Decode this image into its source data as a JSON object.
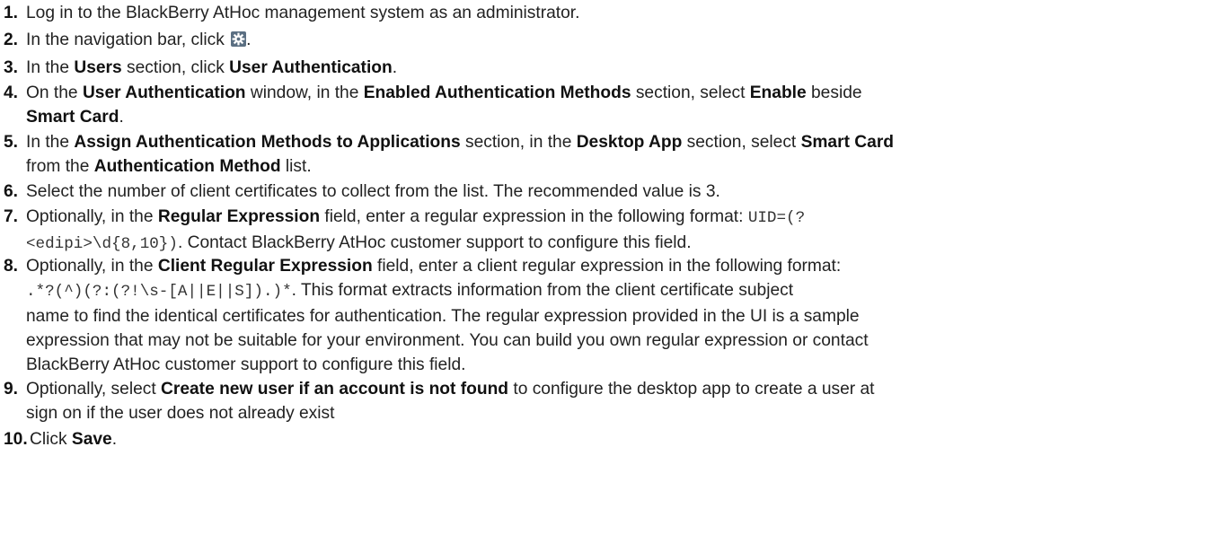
{
  "steps": [
    {
      "number": "1.",
      "parts": {
        "a": "Log in to the BlackBerry AtHoc management system as an administrator."
      }
    },
    {
      "number": "2.",
      "parts": {
        "a": "In the navigation bar, click",
        "icon": "gear-icon",
        "b": "."
      }
    },
    {
      "number": "3.",
      "parts": {
        "a": "In the ",
        "b1": "Users",
        "c": " section, click ",
        "b2": "User Authentication",
        "d": "."
      }
    },
    {
      "number": "4.",
      "parts": {
        "a": "On the ",
        "b1": "User Authentication",
        "c": " window, in the ",
        "b2": "Enabled Authentication Methods",
        "d": " section, select ",
        "b3": "Enable",
        "e": " beside",
        "b4": "Smart Card",
        "f": "."
      }
    },
    {
      "number": "5.",
      "parts": {
        "a": "In the ",
        "b1": "Assign Authentication Methods to Applications",
        "c": " section, in the ",
        "b2": "Desktop App",
        "d": " section, select ",
        "b3": "Smart Card",
        "e": "from the ",
        "b4": "Authentication Method",
        "f": " list."
      }
    },
    {
      "number": "6.",
      "parts": {
        "a": "Select the number of client certificates to collect from the list. The recommended value is 3."
      }
    },
    {
      "number": "7.",
      "parts": {
        "a": "Optionally, in the ",
        "b1": "Regular Expression",
        "c": " field, enter a regular expression in the following format: ",
        "code1": "UID=(?",
        "code2": "<edipi>\\d{8,10})",
        "d": ". Contact BlackBerry AtHoc customer support to configure this field."
      }
    },
    {
      "number": "8.",
      "parts": {
        "a": "Optionally, in the ",
        "b1": "Client Regular Expression",
        "c": " field, enter a client regular expression in the following format:",
        "code1": ".*?(^)(?:(?!\\s-[A||E||S]).)*",
        "d": ". This format extracts information from the client certificate subject",
        "e": "name to find the identical certificates for authentication. The regular expression provided in the UI is a sample",
        "f": "expression that may not be suitable for your environment. You can build you own regular expression or contact",
        "g": "BlackBerry AtHoc customer support to configure this field."
      }
    },
    {
      "number": "9.",
      "parts": {
        "a": "Optionally, select ",
        "b1": "Create new user if an account is not found",
        "c": " to configure the desktop app to create a user at",
        "d": "sign on if the user does not already exist"
      }
    },
    {
      "number": "10.",
      "parts": {
        "a": "Click ",
        "b1": "Save",
        "c": "."
      }
    }
  ]
}
